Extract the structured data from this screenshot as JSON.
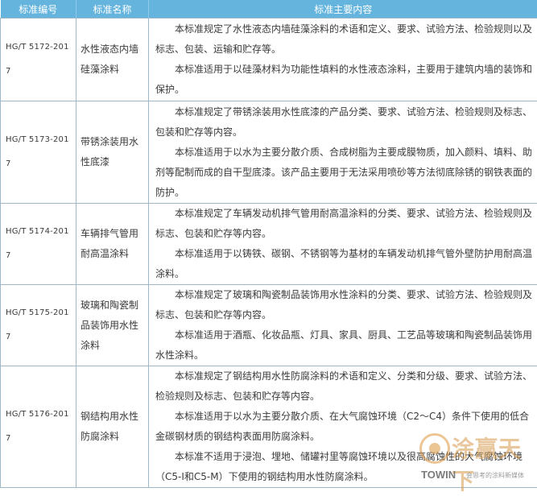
{
  "table": {
    "headers": [
      "标准编号",
      "标准名称",
      "标准主要内容"
    ],
    "rows": [
      {
        "code": "HG/T 5172-2017",
        "name": "水性液态内墙硅藻涂料",
        "content": [
          "本标准规定了水性液态内墙硅藻涂料的术语和定义、要求、试验方法、检验规则以及标志、包装、运输和贮存等。",
          "本标准适用于以硅藻材料为功能性填料的水性液态涂料，主要用于建筑内墙的装饰和保护。"
        ]
      },
      {
        "code": "HG/T 5173-2017",
        "name": "带锈涂装用水性底漆",
        "content": [
          "本标准规定了带锈涂装用水性底漆的产品分类、要求、试验方法、检验规则及标志、包装和贮存等内容。",
          "本标准适用于以水为主要分散介质、合成树脂为主要成膜物质，加入颜料、填料、助剂等配制而成的自干型底漆。该产品主要用于无法采用喷砂等方法彻底除锈的钢铁表面的防护。"
        ]
      },
      {
        "code": "HG/T 5174-2017",
        "name": "车辆排气管用耐高温涂料",
        "content": [
          "本标准规定了车辆发动机排气管用耐高温涂料的分类、要求、试验方法、检验规则及标志、包装和贮存等内容。",
          "本标准适用于以铸铁、碳钢、不锈钢等为基材的车辆发动机排气管外壁防护用耐高温涂料。"
        ]
      },
      {
        "code": "HG/T 5175-2017",
        "name": "玻璃和陶瓷制品装饰用水性涂料",
        "content": [
          "本标准规定了玻璃和陶瓷制品装饰用水性涂料的分类、要求、试验方法、检验规则及标志、包装和贮存等内容。",
          "本标准适用于酒瓶、化妆品瓶、灯具、家具、厨具、工艺品等玻璃和陶瓷制品装饰用水性涂料。"
        ]
      },
      {
        "code": "HG/T 5176-2017",
        "name": "钢结构用水性防腐涂料",
        "content": [
          "本标准规定了钢结构用水性防腐涂料的术语和定义、分类和分级、要求、试验方法、检验规则及标志、包装和贮存等内容。",
          "本标准适用于以水为主要分散介质、在大气腐蚀环境（C2～C4）条件下使用的低合金碳钢材质的钢结构表面用防腐涂料。",
          "本标准不适用于浸泡、埋地、储罐衬里等腐蚀环境以及很高腐蚀性的大气腐蚀环境（C5-I和C5-M）下使用的钢结构用水性防腐涂料。"
        ]
      }
    ]
  },
  "watermark": {
    "title": "涂赢天下",
    "brand": "TOWIN",
    "slogan": "会思考的涂料新媒体",
    "color": "#d79a4e"
  },
  "colors": {
    "header_bg": "#65b4dd",
    "border": "#9fb8c8",
    "text": "#3a3a3a"
  }
}
